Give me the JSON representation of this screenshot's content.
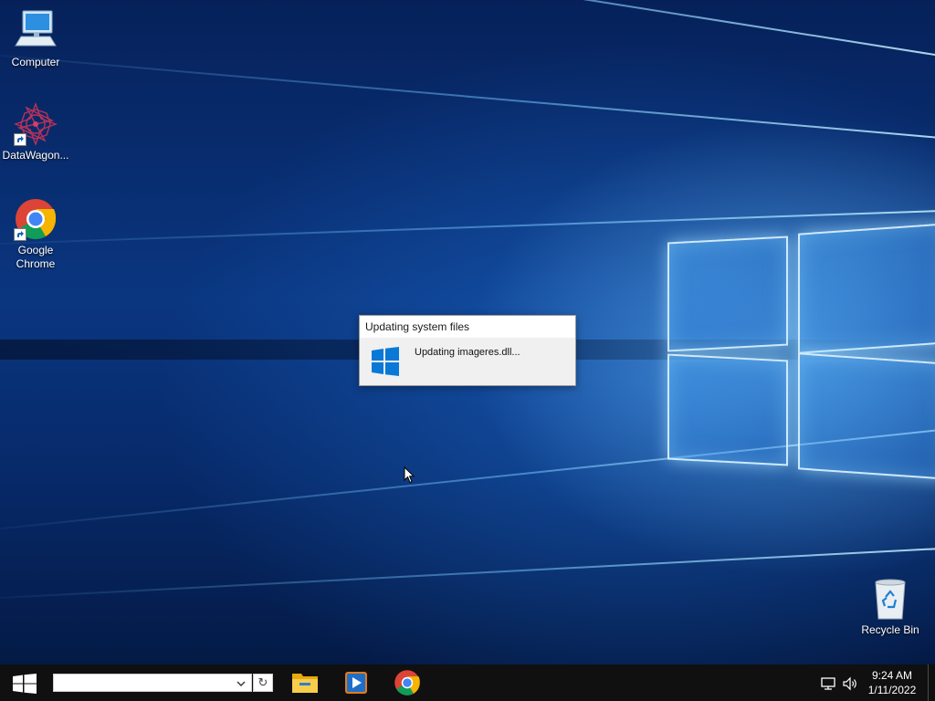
{
  "desktop": {
    "icons": [
      {
        "label": "Computer",
        "icon": "computer-icon"
      },
      {
        "label": "DataWagon...",
        "icon": "datawagon-icon"
      },
      {
        "label": "Google\nChrome",
        "icon": "chrome-icon"
      },
      {
        "label": "Recycle Bin",
        "icon": "recycle-bin-icon"
      }
    ]
  },
  "dialog": {
    "title": "Updating system files",
    "message": "Updating imageres.dll...",
    "icon": "windows-logo-icon"
  },
  "taskbar": {
    "start_icon": "windows-start-icon",
    "search_value": "",
    "pinned": [
      {
        "name": "File Explorer",
        "icon": "file-explorer-icon"
      },
      {
        "name": "Media Player",
        "icon": "media-player-icon"
      },
      {
        "name": "Google Chrome",
        "icon": "chrome-icon"
      }
    ],
    "tray": {
      "network_icon": "network-icon",
      "volume_icon": "volume-icon",
      "time": "9:24 AM",
      "date": "1/11/2022"
    }
  },
  "colors": {
    "taskbar": "#101010",
    "windows_blue": "#0a78d7",
    "dialog_bg": "#f0f0f0"
  }
}
